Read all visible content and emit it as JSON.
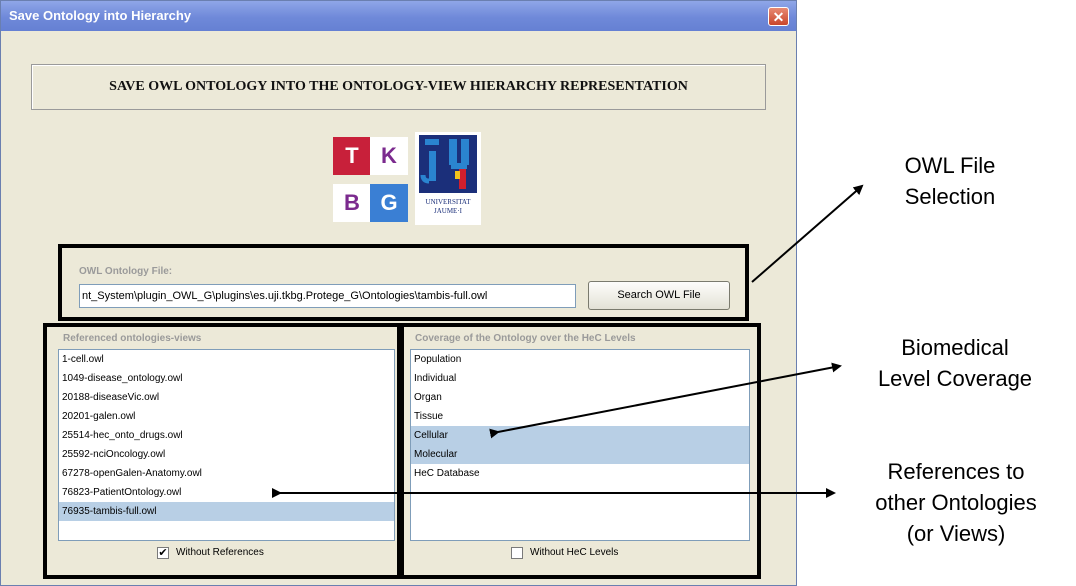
{
  "window": {
    "title": "Save Ontology into Hierarchy",
    "close_glyph": "✕"
  },
  "header": {
    "title": "SAVE OWL ONTOLOGY INTO THE ONTOLOGY-VIEW HIERARCHY REPRESENTATION"
  },
  "logos": {
    "tkbg": {
      "t": "T",
      "k": "K",
      "b": "B",
      "g": "G",
      "colors": {
        "t": "#c8203a",
        "k_text": "#7b2a8e",
        "b_text": "#7b2a8e",
        "g": "#3a7fd4"
      }
    },
    "uji": {
      "line1": "UNIVERSITAT",
      "line2": "JAUME·I"
    }
  },
  "file_panel": {
    "label": "OWL Ontology File:",
    "path_value": "nt_System\\plugin_OWL_G\\plugins\\es.uji.tkbg.Protege_G\\Ontologies\\tambis-full.owl",
    "search_button": "Search OWL File"
  },
  "references": {
    "label": "Referenced ontologies-views",
    "items": [
      {
        "label": "1-cell.owl",
        "selected": false
      },
      {
        "label": "1049-disease_ontology.owl",
        "selected": false
      },
      {
        "label": "20188-diseaseVic.owl",
        "selected": false
      },
      {
        "label": "20201-galen.owl",
        "selected": false
      },
      {
        "label": "25514-hec_onto_drugs.owl",
        "selected": false
      },
      {
        "label": "25592-nciOncology.owl",
        "selected": false
      },
      {
        "label": "67278-openGalen-Anatomy.owl",
        "selected": false
      },
      {
        "label": "76823-PatientOntology.owl",
        "selected": false
      },
      {
        "label": "76935-tambis-full.owl",
        "selected": true
      }
    ],
    "checkbox_label": "Without References",
    "checkbox_checked": true,
    "check_glyph": "✔"
  },
  "coverage": {
    "label": "Coverage of the Ontology over the HeC Levels",
    "items": [
      {
        "label": "Population",
        "selected": false
      },
      {
        "label": "Individual",
        "selected": false
      },
      {
        "label": "Organ",
        "selected": false
      },
      {
        "label": "Tissue",
        "selected": false
      },
      {
        "label": "Cellular",
        "selected": true
      },
      {
        "label": "Molecular",
        "selected": true
      },
      {
        "label": "HeC Database",
        "selected": false
      }
    ],
    "checkbox_label": "Without HeC Levels",
    "checkbox_checked": false
  },
  "annotations": {
    "owl_file_selection": [
      "OWL File",
      "Selection"
    ],
    "biomedical_coverage": [
      "Biomedical",
      "Level Coverage"
    ],
    "references_other": [
      "References to",
      "other Ontologies",
      "(or Views)"
    ]
  }
}
